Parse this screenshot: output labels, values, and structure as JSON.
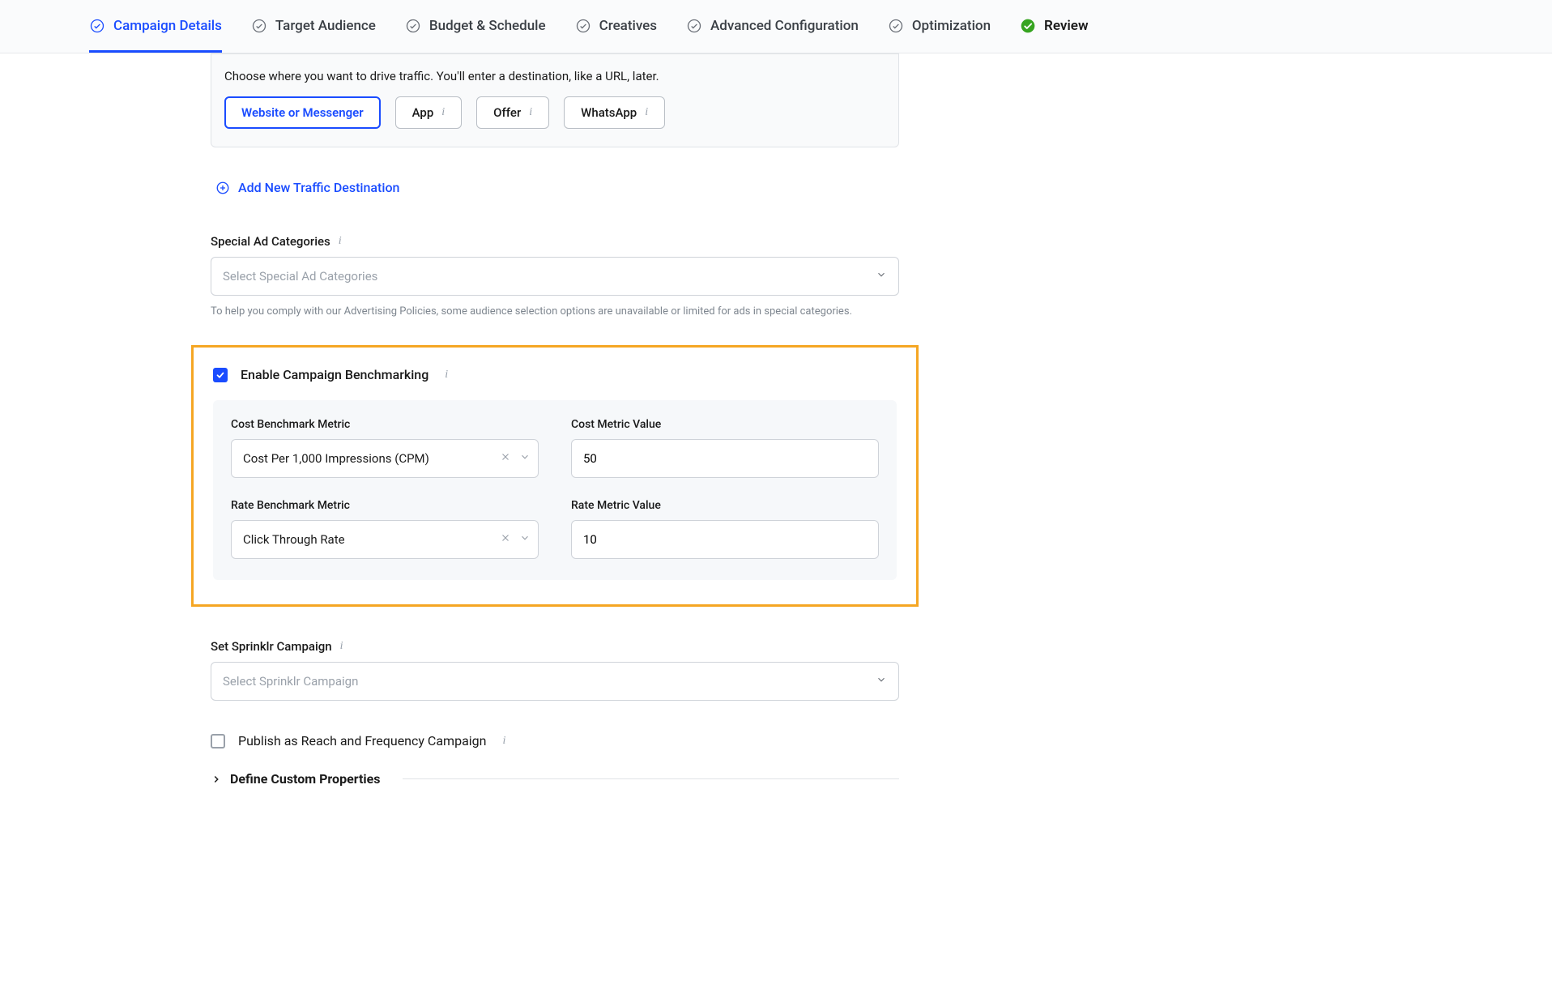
{
  "tabs": {
    "campaign_details": "Campaign Details",
    "target_audience": "Target Audience",
    "budget_schedule": "Budget & Schedule",
    "creatives": "Creatives",
    "advanced_config": "Advanced Configuration",
    "optimization": "Optimization",
    "review": "Review"
  },
  "traffic": {
    "prompt": "Choose where you want to drive traffic. You'll enter a destination, like a URL, later.",
    "options": {
      "website_messenger": "Website or Messenger",
      "app": "App",
      "offer": "Offer",
      "whatsapp": "WhatsApp"
    },
    "add_new": "Add New Traffic Destination"
  },
  "special_ad": {
    "label": "Special Ad Categories",
    "placeholder": "Select Special Ad Categories",
    "helper": "To help you comply with our Advertising Policies, some audience selection options are unavailable or limited for ads in special categories."
  },
  "benchmark": {
    "enable_label": "Enable Campaign Benchmarking",
    "cost_metric_label": "Cost Benchmark Metric",
    "cost_metric_value_label": "Cost Metric Value",
    "rate_metric_label": "Rate Benchmark Metric",
    "rate_metric_value_label": "Rate Metric Value",
    "cost_metric_selected": "Cost Per 1,000 Impressions (CPM)",
    "rate_metric_selected": "Click Through Rate",
    "cost_value": "50",
    "rate_value": "10"
  },
  "sprinklr_campaign": {
    "label": "Set Sprinklr Campaign",
    "placeholder": "Select Sprinklr Campaign"
  },
  "reach_freq": {
    "label": "Publish as Reach and Frequency Campaign"
  },
  "custom_props": {
    "label": "Define Custom Properties"
  }
}
